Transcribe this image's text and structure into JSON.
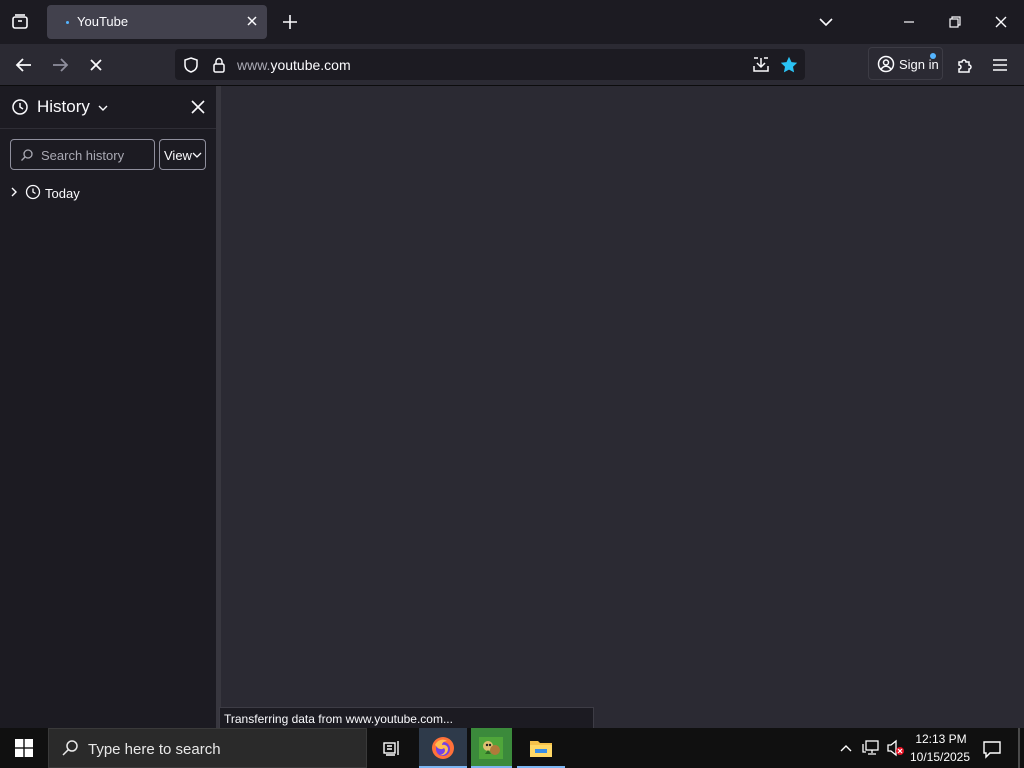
{
  "tab": {
    "title": "YouTube"
  },
  "url": {
    "prefix": "www.",
    "domain": "youtube.com"
  },
  "signin": {
    "label": "Sign in"
  },
  "sidebar": {
    "title": "History",
    "search_placeholder": "Search history",
    "view_label": "View",
    "items": [
      {
        "label": "Today"
      }
    ]
  },
  "status": {
    "text": "Transferring data from www.youtube.com..."
  },
  "taskbar": {
    "search_placeholder": "Type here to search",
    "time": "12:13 PM",
    "date": "10/15/2025"
  },
  "colors": {
    "accent": "#54b4ff",
    "bookmark_star": "#2ac3f5",
    "toolbar_bg": "#2b2a33",
    "tabstrip_bg": "#1c1b22"
  }
}
